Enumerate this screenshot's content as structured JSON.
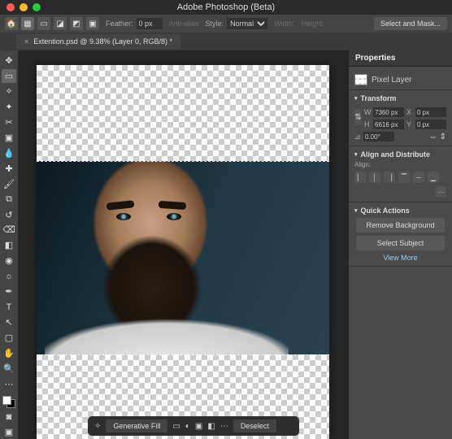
{
  "app_title": "Adobe Photoshop (Beta)",
  "options_bar": {
    "feather_label": "Feather:",
    "feather_value": "0 px",
    "antialias_label": "Anti-alias",
    "style_label": "Style:",
    "style_value": "Normal",
    "width_label": "Width:",
    "height_label": "Height:",
    "select_mask_label": "Select and Mask..."
  },
  "document_tab": {
    "title": "Extention.psd @ 9.38% (Layer 0, RGB/8) *"
  },
  "context_bar": {
    "generative_fill": "Generative Fill",
    "deselect": "Deselect"
  },
  "properties": {
    "tab_label": "Properties",
    "layer_type": "Pixel Layer",
    "transform": {
      "title": "Transform",
      "w": "7360 px",
      "h": "6616 px",
      "x": "0 px",
      "y": "0 px",
      "angle": "0.00°"
    },
    "align": {
      "title": "Align and Distribute",
      "sub": "Align:"
    },
    "quick_actions": {
      "title": "Quick Actions",
      "remove_bg": "Remove Background",
      "select_subject": "Select Subject",
      "view_more": "View More"
    }
  }
}
